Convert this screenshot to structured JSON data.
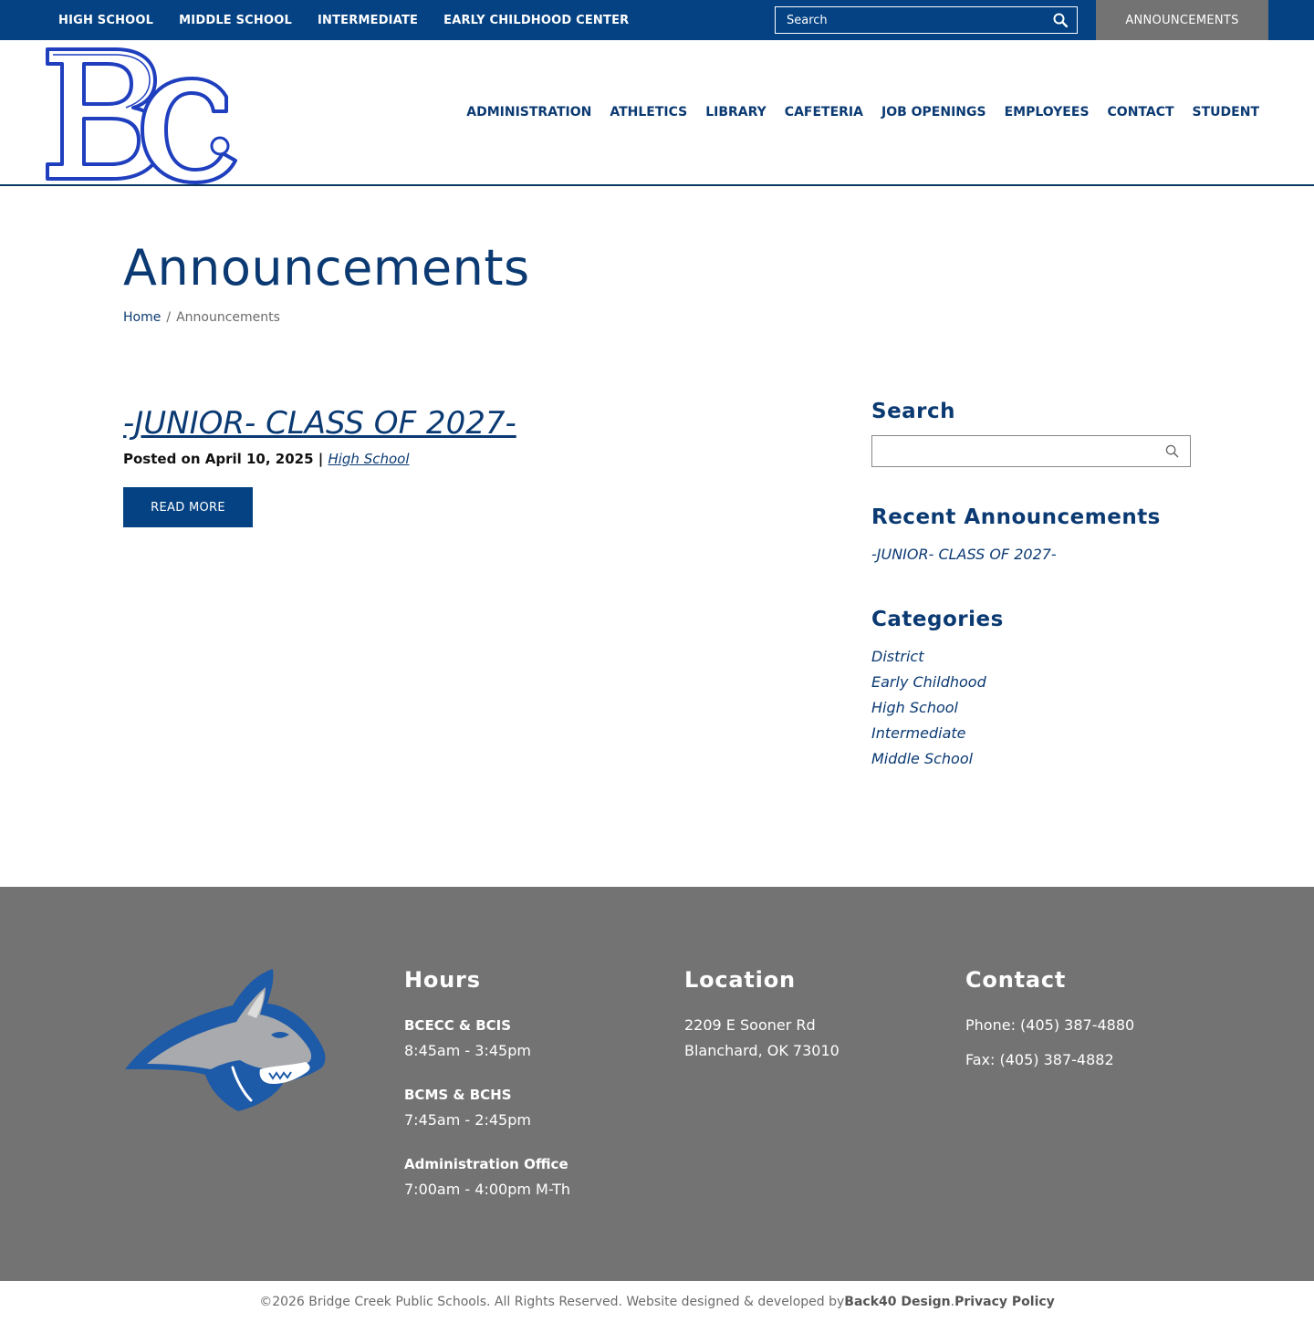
{
  "topbar": {
    "school_links": [
      "HIGH SCHOOL",
      "MIDDLE SCHOOL",
      "INTERMEDIATE",
      "EARLY CHILDHOOD CENTER"
    ],
    "search_placeholder": "Search",
    "announcements_label": "ANNOUNCEMENTS"
  },
  "header": {
    "nav": [
      "ADMINISTRATION",
      "ATHLETICS",
      "LIBRARY",
      "CAFETERIA",
      "JOB OPENINGS",
      "EMPLOYEES",
      "CONTACT",
      "STUDENT"
    ]
  },
  "page": {
    "title": "Announcements",
    "breadcrumb_home": "Home",
    "breadcrumb_sep": "/",
    "breadcrumb_current": "Announcements"
  },
  "post": {
    "title": "-JUNIOR- CLASS OF 2027-",
    "posted": "Posted on April 10, 2025",
    "sep": " | ",
    "category": "High School",
    "read_more": "READ MORE"
  },
  "sidebar": {
    "search_heading": "Search",
    "recent_heading": "Recent Announcements",
    "recent": [
      "-JUNIOR- CLASS OF 2027-"
    ],
    "categories_heading": "Categories",
    "categories": [
      "District",
      "Early Childhood",
      "High School",
      "Intermediate",
      "Middle School"
    ]
  },
  "footer": {
    "hours_heading": "Hours",
    "hours": [
      {
        "label": "BCECC & BCIS",
        "time": "8:45am - 3:45pm"
      },
      {
        "label": "BCMS & BCHS",
        "time": "7:45am - 2:45pm"
      },
      {
        "label": "Administration Office",
        "time": "7:00am - 4:00pm M-Th"
      }
    ],
    "location_heading": "Location",
    "address_line1": "2209 E Sooner Rd",
    "address_line2": "Blanchard, OK 73010",
    "contact_heading": "Contact",
    "phone": "Phone: (405) 387-4880",
    "fax": "Fax: (405) 387-4882"
  },
  "copyright": {
    "text": "©2026 Bridge Creek Public Schools. All Rights Reserved. Website designed & developed by ",
    "designer": "Back40 Design",
    "dot": ". ",
    "privacy": "Privacy Policy"
  },
  "colors": {
    "primary": "#044283",
    "heading": "#0b3a73",
    "footer_bg": "#737373",
    "logo_blue": "#1f3fbf"
  },
  "icons": {
    "topbar_search": "search-icon",
    "sidebar_search": "search-icon",
    "logo": "bc-logo",
    "mascot": "bobcat-mascot"
  }
}
